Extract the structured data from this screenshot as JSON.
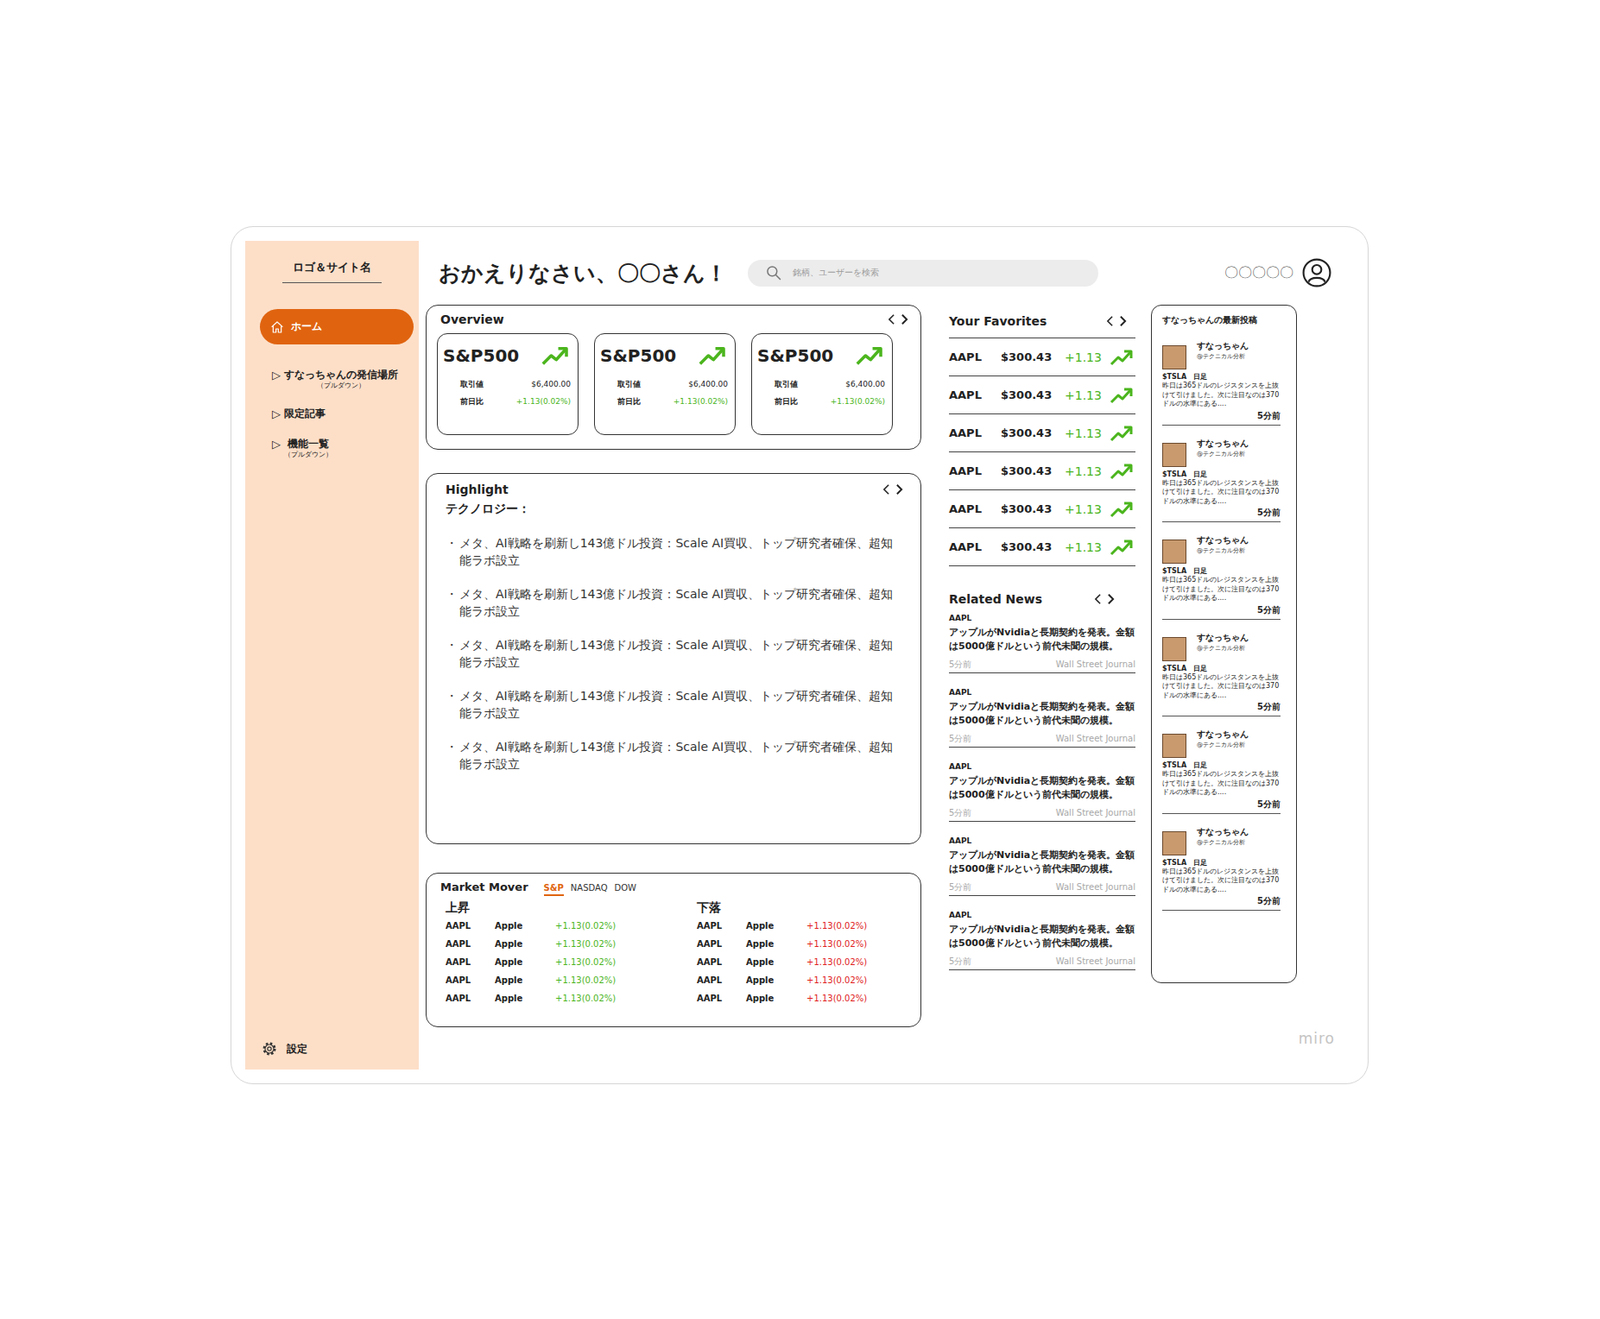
{
  "sidebar": {
    "logo": "ロゴ＆サイト名",
    "items": [
      {
        "label": "ホーム",
        "selected": true
      },
      {
        "label": "すなっちゃんの発信場所",
        "icon": "▷",
        "note": "（プルダウン）",
        "selected": false
      },
      {
        "label": "限定記事",
        "icon": "▷",
        "selected": false
      },
      {
        "label": "機能一覧",
        "icon": "▷",
        "note": "（プルダウン）",
        "selected": false
      }
    ],
    "settings": "設定"
  },
  "header": {
    "greeting": "おかえりなさい、〇〇さん！",
    "search_placeholder": "銘柄、ユーザーを検索",
    "username": "〇〇〇〇〇"
  },
  "overview": {
    "title": "Overview",
    "cards": [
      {
        "name": "S&P500",
        "price_label": "取引値",
        "price": "$6,400.00",
        "change_label": "前日比",
        "change": "+1.13(0.02%)",
        "trend": "up"
      },
      {
        "name": "S&P500",
        "price_label": "取引値",
        "price": "$6,400.00",
        "change_label": "前日比",
        "change": "+1.13(0.02%)",
        "trend": "up"
      },
      {
        "name": "S&P500",
        "price_label": "取引値",
        "price": "$6,400.00",
        "change_label": "前日比",
        "change": "+1.13(0.02%)",
        "trend": "up"
      }
    ]
  },
  "highlight": {
    "title": "Highlight",
    "category": "テクノロジー：",
    "bullet": "・",
    "items": [
      "メタ、AI戦略を刷新し143億ドル投資：Scale AI買収、トップ研究者確保、超知能ラボ設立",
      "メタ、AI戦略を刷新し143億ドル投資：Scale AI買収、トップ研究者確保、超知能ラボ設立",
      "メタ、AI戦略を刷新し143億ドル投資：Scale AI買収、トップ研究者確保、超知能ラボ設立",
      "メタ、AI戦略を刷新し143億ドル投資：Scale AI買収、トップ研究者確保、超知能ラボ設立",
      "メタ、AI戦略を刷新し143億ドル投資：Scale AI買収、トップ研究者確保、超知能ラボ設立"
    ]
  },
  "market_mover": {
    "title": "Market Mover",
    "tabs": [
      {
        "label": "S&P",
        "selected": true
      },
      {
        "label": "NASDAQ",
        "selected": false
      },
      {
        "label": "DOW",
        "selected": false
      }
    ],
    "gainers": {
      "title": "上昇",
      "rows": [
        {
          "ticker": "AAPL",
          "name": "Apple",
          "change": "+1.13(0.02%)"
        },
        {
          "ticker": "AAPL",
          "name": "Apple",
          "change": "+1.13(0.02%)"
        },
        {
          "ticker": "AAPL",
          "name": "Apple",
          "change": "+1.13(0.02%)"
        },
        {
          "ticker": "AAPL",
          "name": "Apple",
          "change": "+1.13(0.02%)"
        },
        {
          "ticker": "AAPL",
          "name": "Apple",
          "change": "+1.13(0.02%)"
        }
      ]
    },
    "losers": {
      "title": "下落",
      "rows": [
        {
          "ticker": "AAPL",
          "name": "Apple",
          "change": "+1.13(0.02%)"
        },
        {
          "ticker": "AAPL",
          "name": "Apple",
          "change": "+1.13(0.02%)"
        },
        {
          "ticker": "AAPL",
          "name": "Apple",
          "change": "+1.13(0.02%)"
        },
        {
          "ticker": "AAPL",
          "name": "Apple",
          "change": "+1.13(0.02%)"
        },
        {
          "ticker": "AAPL",
          "name": "Apple",
          "change": "+1.13(0.02%)"
        }
      ]
    }
  },
  "favorites": {
    "title": "Your Favorites",
    "rows": [
      {
        "ticker": "AAPL",
        "price": "$300.43",
        "change": "+1.13",
        "trend": "up"
      },
      {
        "ticker": "AAPL",
        "price": "$300.43",
        "change": "+1.13",
        "trend": "up"
      },
      {
        "ticker": "AAPL",
        "price": "$300.43",
        "change": "+1.13",
        "trend": "up"
      },
      {
        "ticker": "AAPL",
        "price": "$300.43",
        "change": "+1.13",
        "trend": "up"
      },
      {
        "ticker": "AAPL",
        "price": "$300.43",
        "change": "+1.13",
        "trend": "up"
      },
      {
        "ticker": "AAPL",
        "price": "$300.43",
        "change": "+1.13",
        "trend": "up"
      }
    ]
  },
  "news": {
    "title": "Related News",
    "items": [
      {
        "ticker": "AAPL",
        "headline": "アップルがNvidiaと長期契約を発表。金額は5000億ドルという前代未聞の規模。",
        "time": "5分前",
        "source": "Wall Street Journal"
      },
      {
        "ticker": "AAPL",
        "headline": "アップルがNvidiaと長期契約を発表。金額は5000億ドルという前代未聞の規模。",
        "time": "5分前",
        "source": "Wall Street Journal"
      },
      {
        "ticker": "AAPL",
        "headline": "アップルがNvidiaと長期契約を発表。金額は5000億ドルという前代未聞の規模。",
        "time": "5分前",
        "source": "Wall Street Journal"
      },
      {
        "ticker": "AAPL",
        "headline": "アップルがNvidiaと長期契約を発表。金額は5000億ドルという前代未聞の規模。",
        "time": "5分前",
        "source": "Wall Street Journal"
      },
      {
        "ticker": "AAPL",
        "headline": "アップルがNvidiaと長期契約を発表。金額は5000億ドルという前代未聞の規模。",
        "time": "5分前",
        "source": "Wall Street Journal"
      }
    ]
  },
  "posts": {
    "title": "すなっちゃんの最新投稿",
    "items": [
      {
        "name": "すなっちゃん",
        "handle": "@テクニカル分析",
        "tag": "$TSLA　日足",
        "text": "昨日は365ドルのレジスタンスを上抜けて引けました。次に注目なのは370ドルの水準にある....",
        "time": "5分前"
      },
      {
        "name": "すなっちゃん",
        "handle": "@テクニカル分析",
        "tag": "$TSLA　日足",
        "text": "昨日は365ドルのレジスタンスを上抜けて引けました。次に注目なのは370ドルの水準にある....",
        "time": "5分前"
      },
      {
        "name": "すなっちゃん",
        "handle": "@テクニカル分析",
        "tag": "$TSLA　日足",
        "text": "昨日は365ドルのレジスタンスを上抜けて引けました。次に注目なのは370ドルの水準にある....",
        "time": "5分前"
      },
      {
        "name": "すなっちゃん",
        "handle": "@テクニカル分析",
        "tag": "$TSLA　日足",
        "text": "昨日は365ドルのレジスタンスを上抜けて引けました。次に注目なのは370ドルの水準にある....",
        "time": "5分前"
      },
      {
        "name": "すなっちゃん",
        "handle": "@テクニカル分析",
        "tag": "$TSLA　日足",
        "text": "昨日は365ドルのレジスタンスを上抜けて引けました。次に注目なのは370ドルの水準にある....",
        "time": "5分前"
      },
      {
        "name": "すなっちゃん",
        "handle": "@テクニカル分析",
        "tag": "$TSLA　日足",
        "text": "昨日は365ドルのレジスタンスを上抜けて引けました。次に注目なのは370ドルの水準にある....",
        "time": "5分前"
      }
    ]
  },
  "watermark": "miro"
}
